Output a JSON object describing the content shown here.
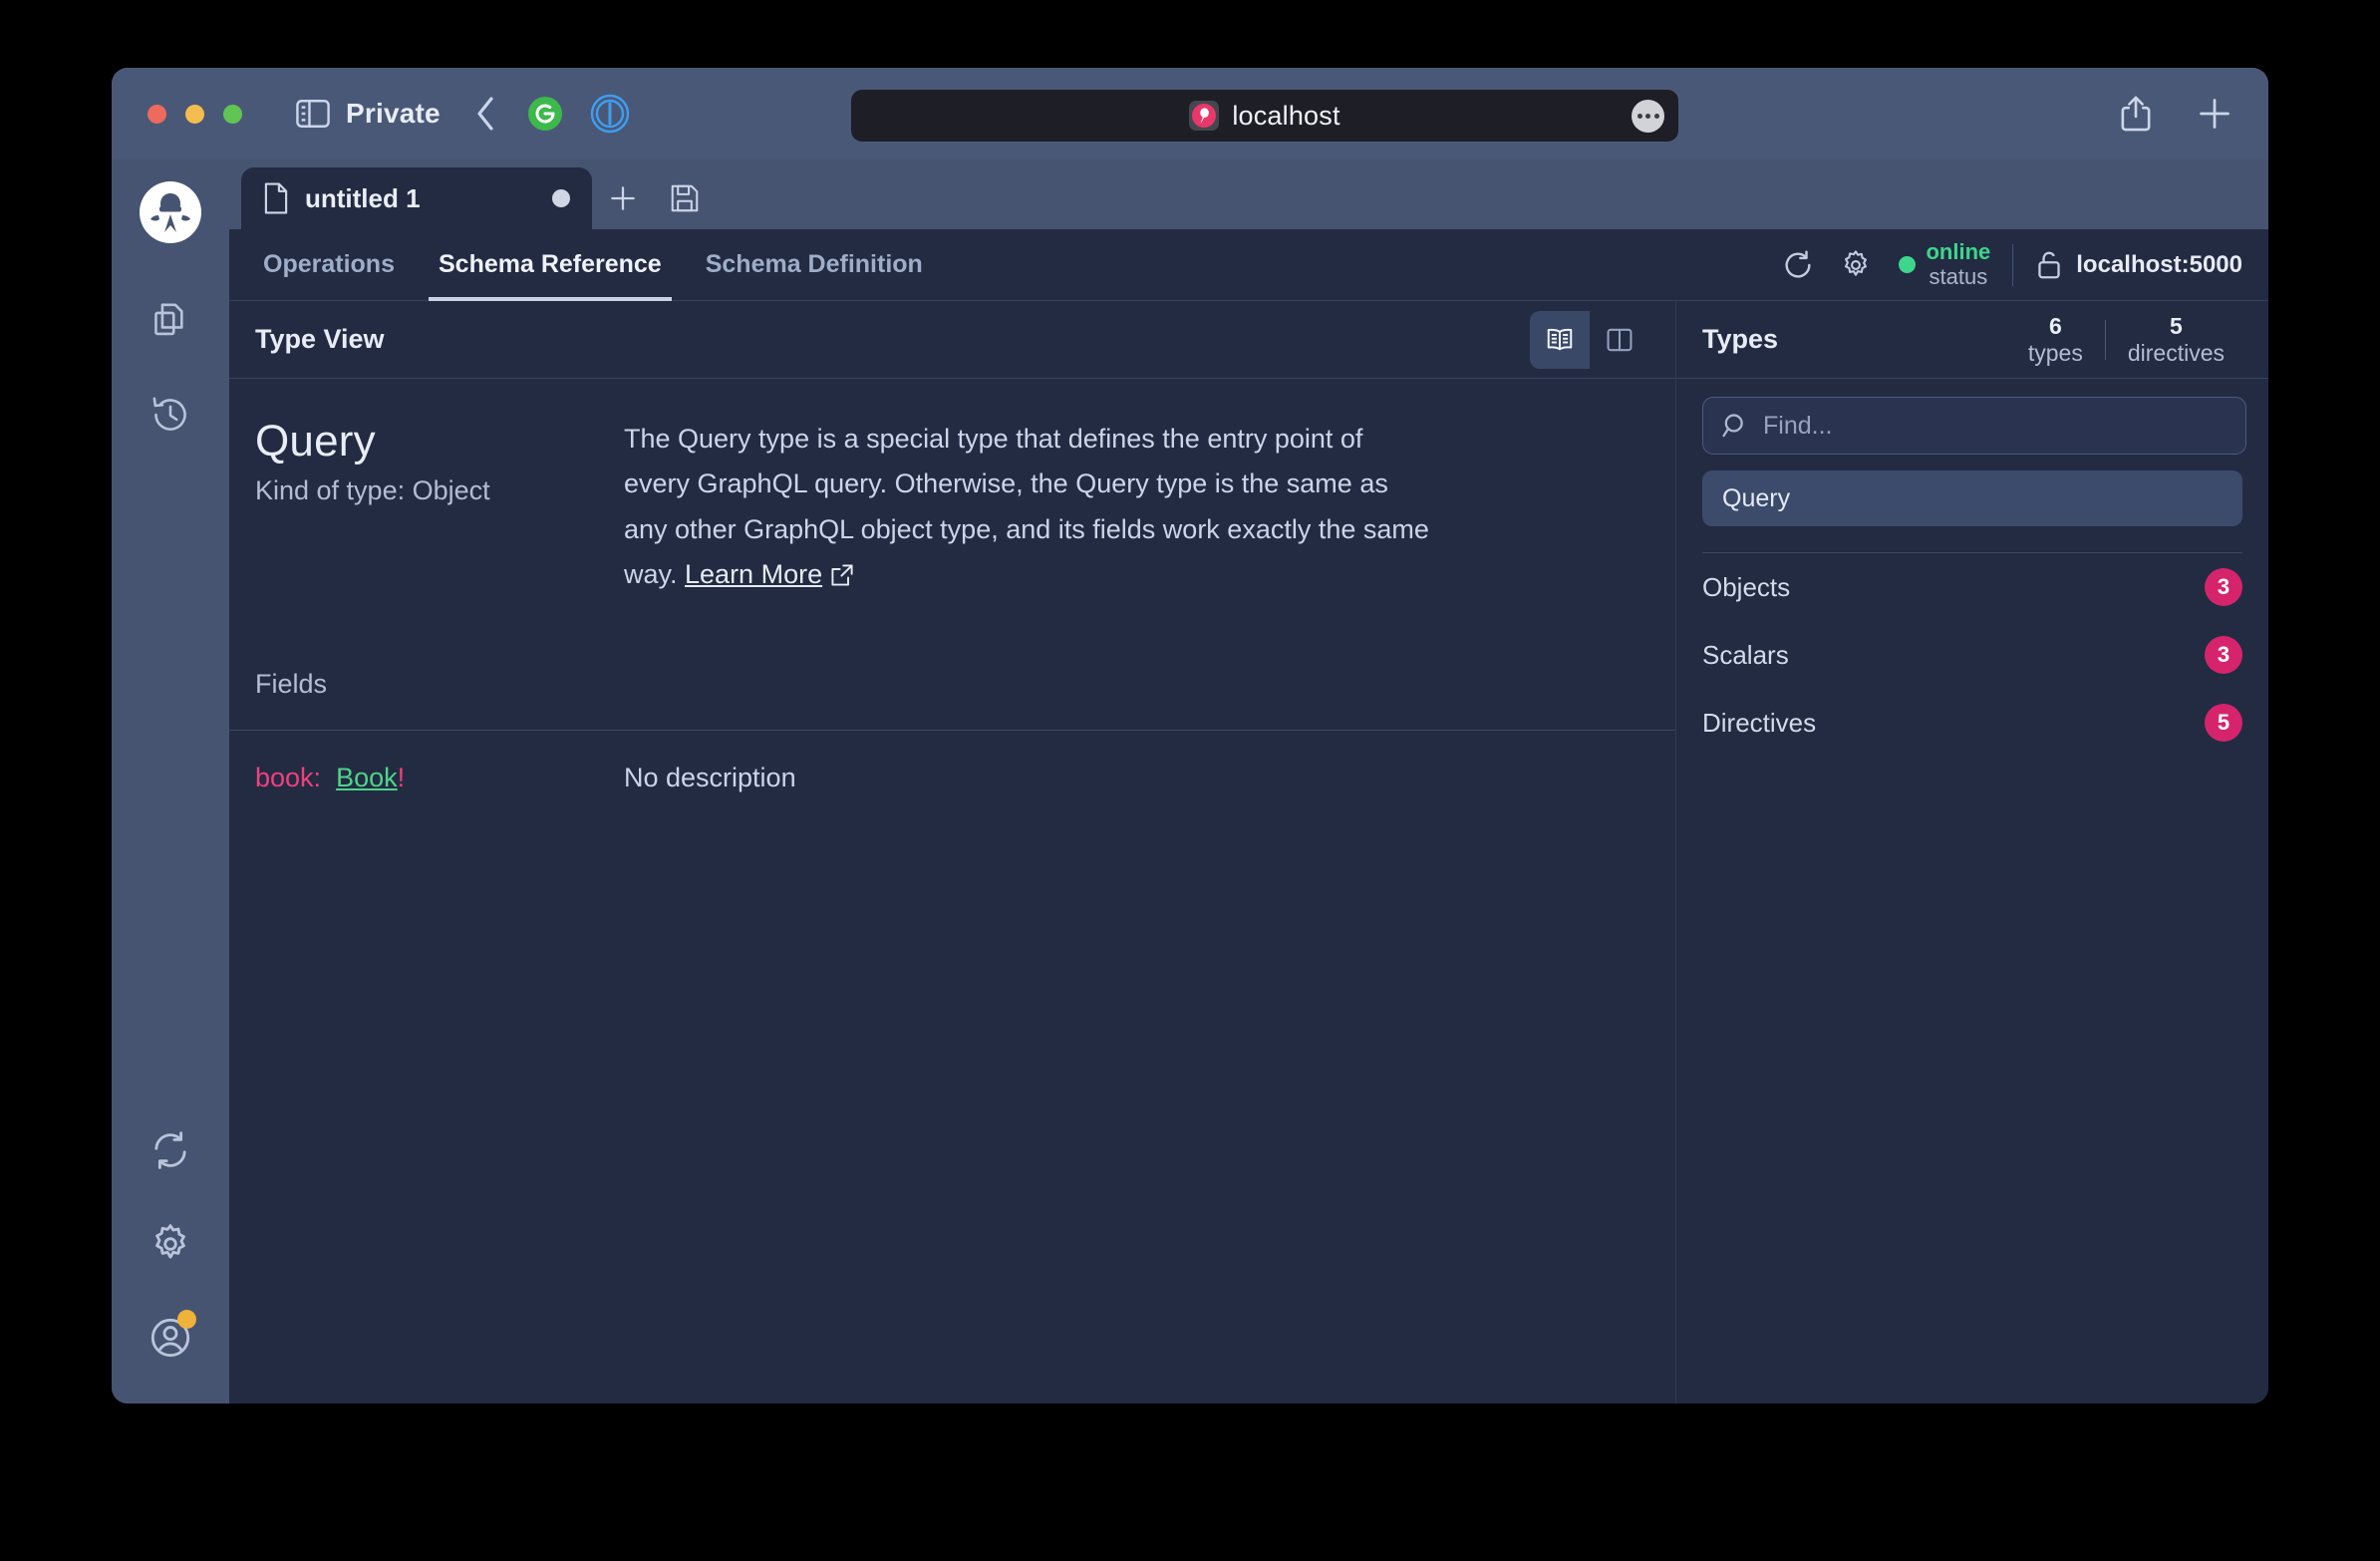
{
  "browser": {
    "private_label": "Private",
    "address_value": "localhost",
    "icons": {
      "sidebar": "sidebar-toggle-icon",
      "back": "back-chevron-icon",
      "grammarly": "grammarly-icon",
      "onepassword": "onepassword-icon",
      "favicon": "altair-favicon-icon",
      "more": "more-options-icon",
      "share": "share-icon",
      "new_tab": "plus-icon"
    }
  },
  "rail": {
    "logo": "altair-logo",
    "items": [
      {
        "name": "docs-icon"
      },
      {
        "name": "history-icon"
      },
      {
        "name": "sync-icon"
      },
      {
        "name": "settings-gear-icon"
      },
      {
        "name": "account-icon"
      }
    ]
  },
  "tabstrip": {
    "tab_label": "untitled 1",
    "add_tab": "plus-icon",
    "save": "save-floppy-icon"
  },
  "subtabs": [
    {
      "label": "Operations",
      "active": false
    },
    {
      "label": "Schema Reference",
      "active": true
    },
    {
      "label": "Schema Definition",
      "active": false
    }
  ],
  "statusbar": {
    "reload": "reload-icon",
    "settings": "gear-icon",
    "status_value": "online",
    "status_caption": "status",
    "status_color": "#3dd68c",
    "endpoint": "localhost:5000"
  },
  "doc": {
    "title": "Type View",
    "view_book": "book-view-icon",
    "view_split": "split-view-icon",
    "type_name": "Query",
    "type_kind": "Kind of type: Object",
    "description": "The Query type is a special type that defines the entry point of every GraphQL query. Otherwise, the Query type is the same as any other GraphQL object type, and its fields work exactly the same way. ",
    "learn_more": "Learn More",
    "fields_label": "Fields",
    "fields": [
      {
        "name": "book:",
        "type": "Book",
        "nonnull": "!",
        "description": "No description"
      }
    ]
  },
  "types": {
    "title": "Types",
    "counters": [
      {
        "num": "6",
        "caption": "types"
      },
      {
        "num": "5",
        "caption": "directives"
      }
    ],
    "search_placeholder": "Find...",
    "search_value": "",
    "selected": "Query",
    "items": [
      {
        "label": "Objects",
        "count": "3"
      },
      {
        "label": "Scalars",
        "count": "3"
      },
      {
        "label": "Directives",
        "count": "5"
      }
    ],
    "badge_color": "#d6246c"
  }
}
